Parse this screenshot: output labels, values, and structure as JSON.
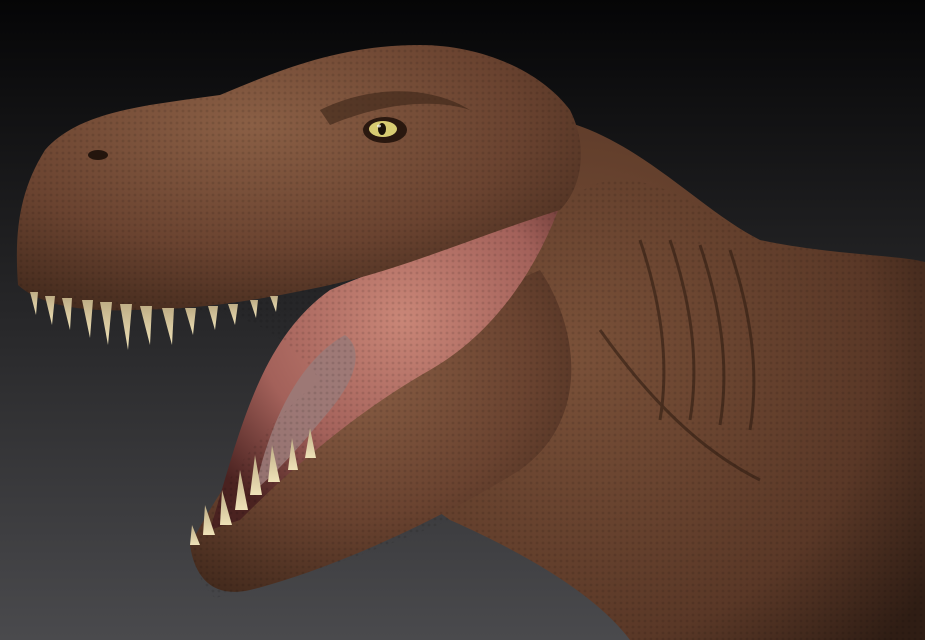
{
  "scene": {
    "subject": "trex-head-sculpt",
    "background": {
      "top": "#050506",
      "bottom": "#4a4a4d"
    },
    "colors": {
      "skin_dark": "#3a2418",
      "skin_mid": "#6a4330",
      "skin_light": "#8a5f45",
      "mouth": "#b86f64",
      "mouth_dark": "#5b2a26",
      "tongue": "#9b7a78",
      "teeth": "#d9c79c",
      "eye": "#d8cc72",
      "pupil": "#1a1208"
    }
  }
}
